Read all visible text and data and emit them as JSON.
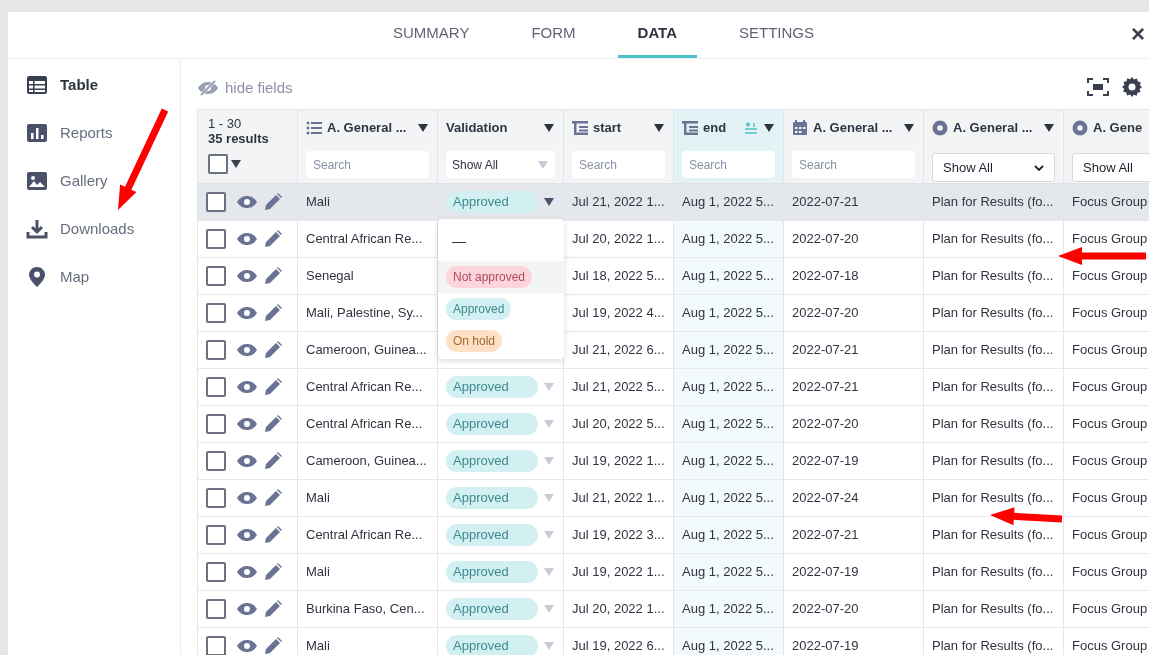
{
  "tabs": [
    {
      "label": "SUMMARY",
      "selected": false
    },
    {
      "label": "FORM",
      "selected": false
    },
    {
      "label": "DATA",
      "selected": true
    },
    {
      "label": "SETTINGS",
      "selected": false
    }
  ],
  "close": "×",
  "sidebar": {
    "items": [
      {
        "label": "Table",
        "selected": true,
        "kind": "table"
      },
      {
        "label": "Reports",
        "selected": false,
        "kind": "reports"
      },
      {
        "label": "Gallery",
        "selected": false,
        "kind": "gallery"
      },
      {
        "label": "Downloads",
        "selected": false,
        "kind": "downloads"
      },
      {
        "label": "Map",
        "selected": false,
        "kind": "map"
      }
    ]
  },
  "toolbar": {
    "hide_fields": "hide fields"
  },
  "table": {
    "range": "1 - 30",
    "results": "35 results",
    "all_checked": false,
    "columns": [
      {
        "label": "A. General ...",
        "kind": "select_multiple",
        "sorted": false,
        "filter": {
          "kind": "search",
          "placeholder": "Search"
        }
      },
      {
        "label": "Validation",
        "kind": "validation",
        "sorted": false,
        "filter": {
          "kind": "custom_select",
          "value": "Show All"
        }
      },
      {
        "label": "start",
        "kind": "datetime",
        "sorted": false,
        "filter": {
          "kind": "search",
          "placeholder": "Search"
        }
      },
      {
        "label": "end",
        "kind": "datetime",
        "sorted": true,
        "filter": {
          "kind": "search",
          "placeholder": "Search"
        }
      },
      {
        "label": "A. General ...",
        "kind": "date",
        "sorted": false,
        "filter": {
          "kind": "search",
          "placeholder": "Search"
        }
      },
      {
        "label": "A. General ...",
        "kind": "select_one",
        "sorted": false,
        "filter": {
          "kind": "select",
          "value": "Show All"
        }
      },
      {
        "label": "A. Gene",
        "kind": "select_one",
        "sorted": false,
        "filter": {
          "kind": "select",
          "value": "Show All"
        }
      }
    ],
    "rows": [
      {
        "checked": false,
        "highlighted": true,
        "menu_open": true,
        "cells": [
          "Mali",
          {
            "kind": "approved",
            "label": "Approved"
          },
          "Jul 21, 2022 1...",
          "Aug 1, 2022 5...",
          "2022-07-21",
          "Plan for Results (fo...",
          "Focus Group"
        ]
      },
      {
        "checked": false,
        "highlighted": false,
        "cells": [
          "Central African Re...",
          null,
          "Jul 20, 2022 1...",
          "Aug 1, 2022 5...",
          "2022-07-20",
          "Plan for Results (fo...",
          "Focus Group"
        ]
      },
      {
        "checked": false,
        "highlighted": false,
        "cells": [
          "Senegal",
          null,
          "Jul 18, 2022 5...",
          "Aug 1, 2022 5...",
          "2022-07-18",
          "Plan for Results (fo...",
          "Focus Group"
        ]
      },
      {
        "checked": false,
        "highlighted": false,
        "cells": [
          "Mali, Palestine, Sy...",
          null,
          "Jul 19, 2022 4...",
          "Aug 1, 2022 5...",
          "2022-07-20",
          "Plan for Results (fo...",
          "Focus Group"
        ]
      },
      {
        "checked": false,
        "highlighted": false,
        "cells": [
          "Cameroon, Guinea...",
          null,
          "Jul 21, 2022 6...",
          "Aug 1, 2022 5...",
          "2022-07-21",
          "Plan for Results (fo...",
          "Focus Group"
        ]
      },
      {
        "checked": false,
        "highlighted": false,
        "menu_open": false,
        "cells": [
          "Central African Re...",
          {
            "kind": "approved",
            "label": "Approved"
          },
          "Jul 21, 2022 5...",
          "Aug 1, 2022 5...",
          "2022-07-21",
          "Plan for Results (fo...",
          "Focus Group"
        ]
      },
      {
        "checked": false,
        "highlighted": false,
        "menu_open": false,
        "cells": [
          "Central African Re...",
          {
            "kind": "approved",
            "label": "Approved"
          },
          "Jul 20, 2022 5...",
          "Aug 1, 2022 5...",
          "2022-07-20",
          "Plan for Results (fo...",
          "Focus Group"
        ]
      },
      {
        "checked": false,
        "highlighted": false,
        "menu_open": false,
        "cells": [
          "Cameroon, Guinea...",
          {
            "kind": "approved",
            "label": "Approved"
          },
          "Jul 19, 2022 1...",
          "Aug 1, 2022 5...",
          "2022-07-19",
          "Plan for Results (fo...",
          "Focus Group"
        ]
      },
      {
        "checked": false,
        "highlighted": false,
        "menu_open": false,
        "cells": [
          "Mali",
          {
            "kind": "approved",
            "label": "Approved"
          },
          "Jul 21, 2022 1...",
          "Aug 1, 2022 5...",
          "2022-07-24",
          "Plan for Results (fo...",
          "Focus Group"
        ]
      },
      {
        "checked": false,
        "highlighted": false,
        "menu_open": false,
        "cells": [
          "Central African Re...",
          {
            "kind": "approved",
            "label": "Approved"
          },
          "Jul 19, 2022 3...",
          "Aug 1, 2022 5...",
          "2022-07-21",
          "Plan for Results (fo...",
          "Focus Group"
        ]
      },
      {
        "checked": false,
        "highlighted": false,
        "menu_open": false,
        "cells": [
          "Mali",
          {
            "kind": "approved",
            "label": "Approved"
          },
          "Jul 19, 2022 1...",
          "Aug 1, 2022 5...",
          "2022-07-19",
          "Plan for Results (fo...",
          "Focus Group"
        ]
      },
      {
        "checked": false,
        "highlighted": false,
        "menu_open": false,
        "cells": [
          "Burkina Faso, Cen...",
          {
            "kind": "approved",
            "label": "Approved"
          },
          "Jul 20, 2022 1...",
          "Aug 1, 2022 5...",
          "2022-07-20",
          "Plan for Results (fo...",
          "Focus Group"
        ]
      },
      {
        "checked": false,
        "highlighted": false,
        "menu_open": false,
        "cells": [
          "Mali",
          {
            "kind": "approved",
            "label": "Approved"
          },
          "Jul 19, 2022 6...",
          "Aug 1, 2022 5...",
          "2022-07-19",
          "Plan for Results (fo...",
          "Focus Group"
        ]
      }
    ]
  },
  "validation_menu": {
    "options": [
      {
        "kind": "empty",
        "label": "—",
        "highlighted": false
      },
      {
        "kind": "not_approved",
        "label": "Not approved",
        "highlighted": true
      },
      {
        "kind": "approved",
        "label": "Approved",
        "highlighted": false
      },
      {
        "kind": "on_hold",
        "label": "On hold",
        "highlighted": false
      }
    ]
  },
  "annotations": [
    {
      "kind": "arrow"
    },
    {
      "kind": "arrow"
    },
    {
      "kind": "arrow"
    }
  ]
}
